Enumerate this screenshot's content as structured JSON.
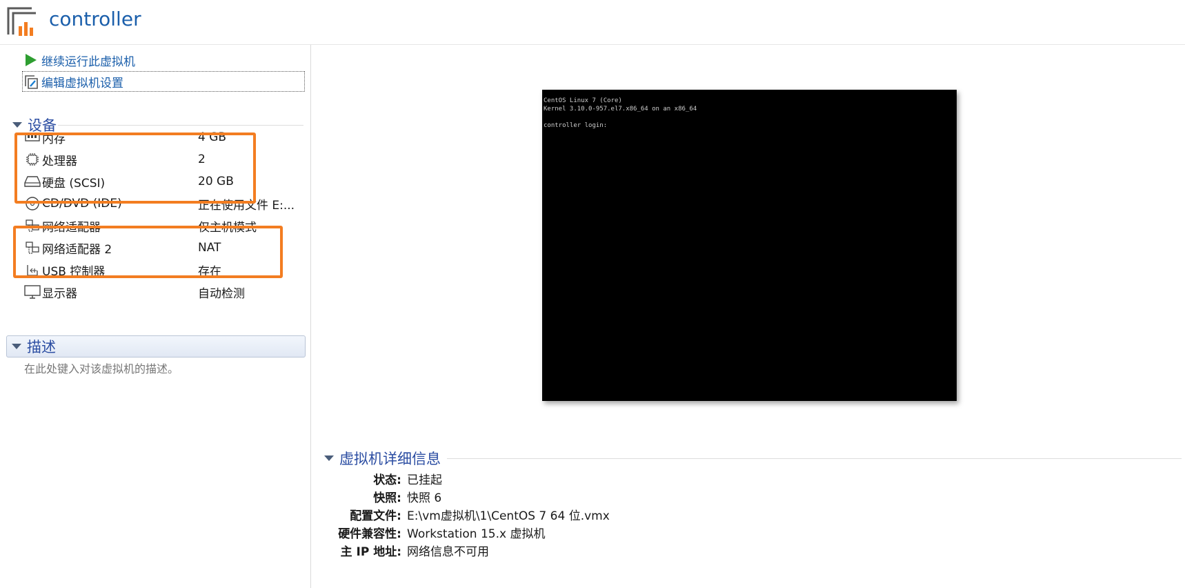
{
  "header": {
    "title": "controller",
    "logo_icon": "vmware-vm-icon"
  },
  "commands": [
    {
      "label": "继续运行此虚拟机",
      "icon": "play-icon"
    },
    {
      "label": "编辑虚拟机设置",
      "icon": "edit-settings-icon"
    }
  ],
  "devices": {
    "title": "设备",
    "items": [
      {
        "icon": "memory-icon",
        "name": "内存",
        "value": "4 GB"
      },
      {
        "icon": "processor-icon",
        "name": "处理器",
        "value": "2"
      },
      {
        "icon": "hard-disk-icon",
        "name": "硬盘 (SCSI)",
        "value": "20 GB"
      },
      {
        "icon": "cd-dvd-icon",
        "name": "CD/DVD (IDE)",
        "value": "正在使用文件 E:..."
      },
      {
        "icon": "network-adapter-icon",
        "name": "网络适配器",
        "value": "仅主机模式"
      },
      {
        "icon": "network-adapter-icon",
        "name": "网络适配器 2",
        "value": "NAT"
      },
      {
        "icon": "usb-icon",
        "name": "USB 控制器",
        "value": "存在"
      },
      {
        "icon": "display-icon",
        "name": "显示器",
        "value": "自动检测"
      }
    ]
  },
  "description": {
    "title": "描述",
    "placeholder": "在此处键入对该虚拟机的描述。"
  },
  "console": {
    "lines": [
      "CentOS Linux 7 (Core)",
      "Kernel 3.10.0-957.el7.x86_64 on an x86_64",
      "",
      "controller login:"
    ]
  },
  "vm_details": {
    "title": "虚拟机详细信息",
    "rows": [
      {
        "label": "状态:",
        "value": "已挂起"
      },
      {
        "label": "快照:",
        "value": "快照 6"
      },
      {
        "label": "配置文件:",
        "value": "E:\\vm虚拟机\\1\\CentOS 7 64 位.vmx"
      },
      {
        "label": "硬件兼容性:",
        "value": "Workstation 15.x 虚拟机"
      },
      {
        "label": "主 IP 地址:",
        "value": "网络信息不可用"
      }
    ]
  },
  "colors": {
    "accent": "#1b5fab",
    "section_title": "#2b4da2",
    "highlight": "#f37d21",
    "console_bg": "#000000"
  }
}
